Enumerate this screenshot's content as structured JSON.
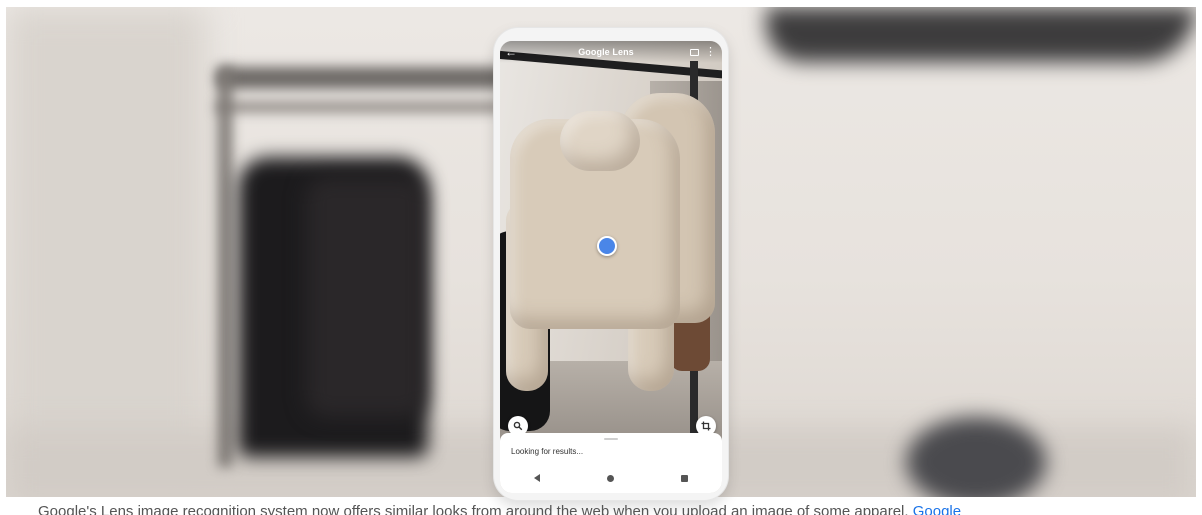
{
  "app": {
    "title": "Google Lens"
  },
  "camera": {
    "status_text": "Looking for results..."
  },
  "icons": {
    "back": "arrow-left-icon",
    "gallery": "gallery-icon",
    "more": "more-vert-icon",
    "search": "search-icon",
    "crop": "crop-icon",
    "nav_back": "triangle-back-icon",
    "nav_home": "circle-home-icon",
    "nav_recent": "square-recent-icon"
  },
  "caption": {
    "text": "Google's Lens image recognition system now offers similar looks from around the web when you upload an image of some apparel.",
    "link": "Google"
  },
  "colors": {
    "focus_dot": "#4a86e8",
    "link": "#1a73e8"
  }
}
